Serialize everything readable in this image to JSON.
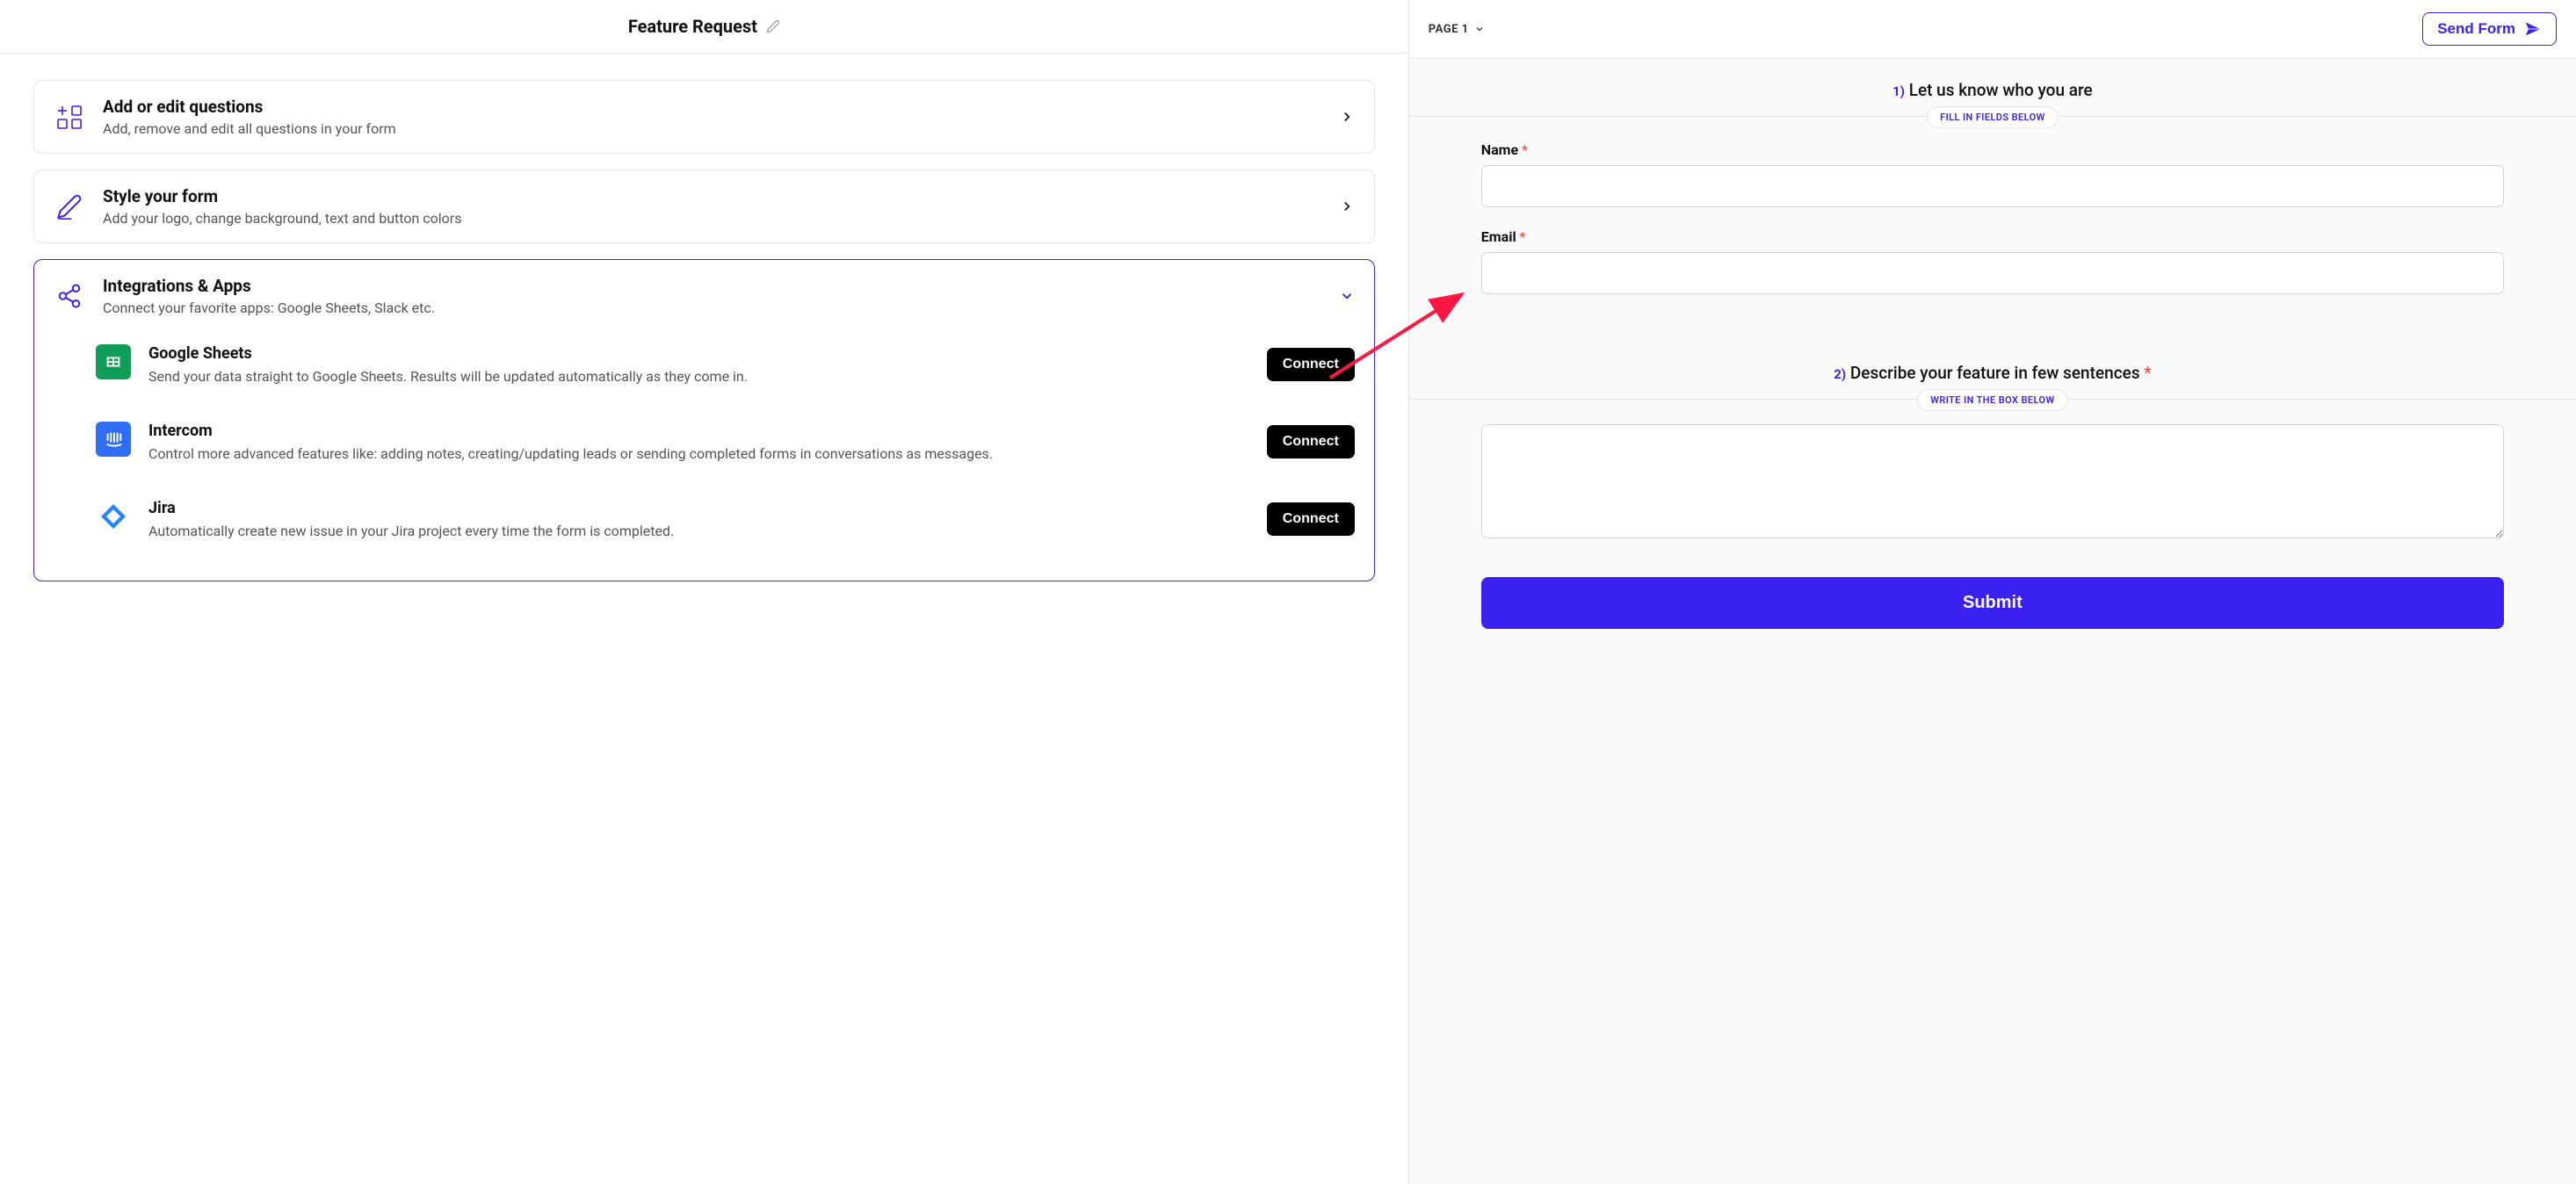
{
  "left": {
    "title": "Feature Request",
    "cards": [
      {
        "title": "Add or edit questions",
        "subtitle": "Add, remove and edit all questions in your form"
      },
      {
        "title": "Style your form",
        "subtitle": "Add your logo, change background, text and button colors"
      },
      {
        "title": "Integrations & Apps",
        "subtitle": "Connect your favorite apps: Google Sheets, Slack etc."
      }
    ],
    "integrations": [
      {
        "name": "Google Sheets",
        "desc": "Send your data straight to Google Sheets. Results will be updated automatically as they come in.",
        "connect": "Connect"
      },
      {
        "name": "Intercom",
        "desc": "Control more advanced features like: adding notes, creating/updating leads or sending completed forms in conversations as messages.",
        "connect": "Connect"
      },
      {
        "name": "Jira",
        "desc": "Automatically create new issue in your Jira project every time the form is completed.",
        "connect": "Connect"
      }
    ]
  },
  "right": {
    "page_label": "PAGE 1",
    "send_form": "Send Form",
    "sections": [
      {
        "num": "1)",
        "title": "Let us know who you are",
        "badge": "FILL IN FIELDS BELOW",
        "fields": [
          {
            "label": "Name",
            "required": true
          },
          {
            "label": "Email",
            "required": true
          }
        ]
      },
      {
        "num": "2)",
        "title": "Describe your feature in few sentences",
        "required": true,
        "badge": "WRITE IN THE BOX BELOW"
      }
    ],
    "submit": "Submit"
  }
}
